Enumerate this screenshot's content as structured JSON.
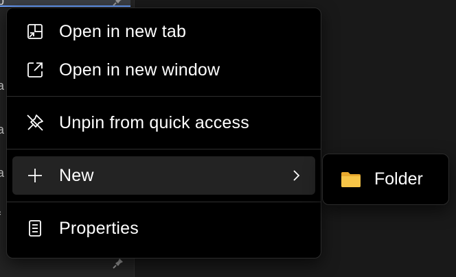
{
  "sidebar": {
    "fragments": [
      "p",
      "a",
      "a",
      "a",
      "f"
    ]
  },
  "menu": {
    "items": [
      {
        "label": "Open in new tab",
        "icon": "open-in-new-tab-icon"
      },
      {
        "label": "Open in new window",
        "icon": "open-in-new-window-icon"
      },
      {
        "label": "Unpin from quick access",
        "icon": "unpin-icon"
      },
      {
        "label": "New",
        "icon": "plus-icon",
        "has_submenu": true
      },
      {
        "label": "Properties",
        "icon": "properties-icon"
      }
    ]
  },
  "submenu": {
    "items": [
      {
        "label": "Folder",
        "icon": "folder-icon",
        "color": "#F7C548"
      }
    ]
  },
  "colors": {
    "menu_background": "#000000",
    "hover_background": "#232323",
    "separator": "#2f2f2f",
    "text": "#ffffff"
  }
}
